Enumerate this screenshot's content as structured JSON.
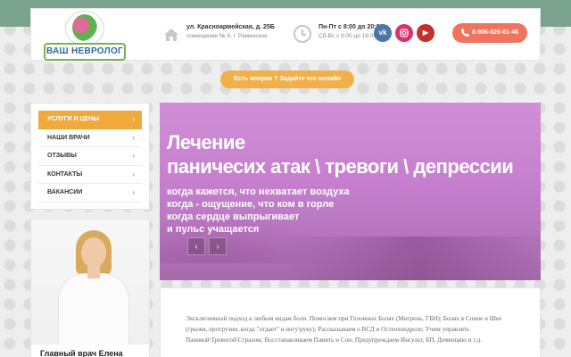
{
  "header": {
    "logo_text": "ВАШ НЕВРОЛОГ",
    "address_line1": "ул. Красноармейская, д. 25Б",
    "address_line2": "помещение № 6, г. Раменское",
    "hours_line1": "Пн-Пт с 8:00 до 20:00",
    "hours_line2": "Сб-Вс с 9:00 до 18:00",
    "social": [
      {
        "name": "vk",
        "label": "vk"
      },
      {
        "name": "instagram",
        "label": "ig"
      },
      {
        "name": "youtube",
        "label": "▶"
      }
    ],
    "phone": "8-906-026-61-46"
  },
  "ask_button": "Есть вопрос ? Задайте его онлайн",
  "menu": {
    "items": [
      {
        "label": "УСЛУГИ И ЦЕНЫ",
        "active": true
      },
      {
        "label": "НАШИ ВРАЧИ",
        "active": false
      },
      {
        "label": "ОТЗЫВЫ",
        "active": false
      },
      {
        "label": "КОНТАКТЫ",
        "active": false
      },
      {
        "label": "ВАКАНСИИ",
        "active": false
      }
    ]
  },
  "doctor_card": {
    "title": "Главный врач Елена"
  },
  "banner": {
    "headline1": "Лечение",
    "headline2": "паничесих атак \\ тревоги \\ депрессии",
    "lines": [
      "когда кажется, что нехватает воздуха",
      "когда - ощущение, что ком в горле",
      "когда сердце выпрыгивает",
      "и пульс учащается"
    ],
    "prev": "‹",
    "next": "›"
  },
  "content": {
    "paragraph": "Эксклюзивный подход к любым видам боли. Помогаем при Головных Болях (Мигрень, ГБН); Болях в Спине и Шее (грыжи, протрузии, когда \"отдает\" в ногу\\руку); Рассказываем о ВСД и Остеохондрозе; Учим управлять Паникой\\Тревогой\\Страхом; Восстанавливаем Память и Сон; Предупреждаем Инсульт, БП, Деменцию и т.д."
  },
  "colors": {
    "accent_orange": "#f2a93b",
    "phone_button": "#f2735d",
    "top_band": "#7aa38e"
  }
}
